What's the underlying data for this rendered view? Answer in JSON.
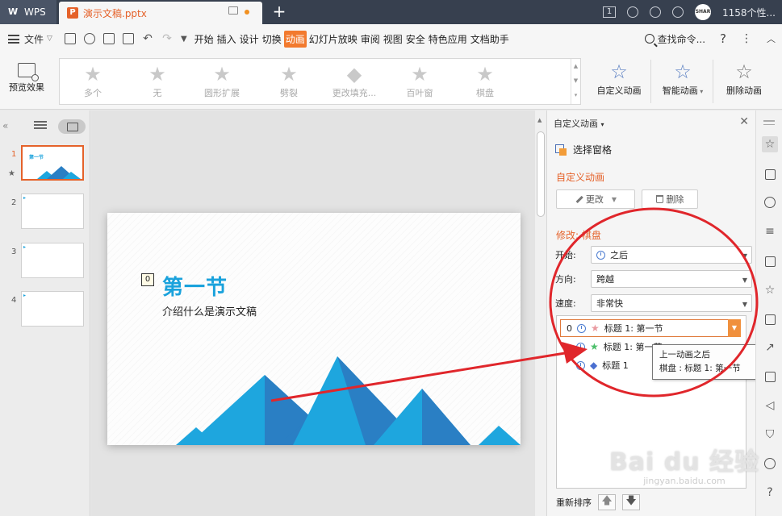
{
  "titlebar": {
    "app_name": "WPS",
    "doc_tab": "演示文稿.pptx",
    "badge": "1",
    "user_name": "1158个性..."
  },
  "menubar": {
    "file": "文件",
    "items": [
      "开始",
      "插入",
      "设计",
      "切换",
      "动画",
      "幻灯片放映",
      "审阅",
      "视图",
      "安全",
      "特色应用",
      "文档助手"
    ],
    "active_index": 4,
    "search": "查找命令...",
    "help": "?"
  },
  "ribbon": {
    "preview": "预览效果",
    "gallery": [
      "多个",
      "无",
      "圆形扩展",
      "劈裂",
      "更改填充...",
      "百叶窗",
      "棋盘"
    ],
    "custom_anim": "自定义动画",
    "smart_anim": "智能动画",
    "delete_anim": "删除动画"
  },
  "thumbnails": {
    "numbers": [
      "1",
      "2",
      "3",
      "4"
    ],
    "active": 1,
    "thumb_title": "第一节"
  },
  "slide": {
    "anim_order": "0",
    "title": "第一节",
    "subtitle": "介绍什么是演示文稿"
  },
  "task_pane": {
    "header": "自定义动画",
    "select_pane": "选择窗格",
    "section_title": "自定义动画",
    "modify_button": "更改",
    "delete_button": "删除",
    "modify_label": "修改: 棋盘",
    "start_label": "开始:",
    "start_value": "之后",
    "direction_label": "方向:",
    "direction_value": "跨越",
    "speed_label": "速度:",
    "speed_value": "非常快",
    "anim_items": [
      {
        "order": "0",
        "text": "标题 1: 第一节"
      },
      {
        "order": "",
        "text": "标题 1: 第一节"
      },
      {
        "order": "",
        "text": "标题 1"
      }
    ],
    "tooltip_line1": "上一动画之后",
    "tooltip_line2": "棋盘 : 标题 1: 第一节",
    "reorder_label": "重新排序"
  },
  "watermark": {
    "main": "Bai du 经验",
    "sub": "jingyan.baidu.com"
  },
  "colors": {
    "accent_orange": "#e5622a",
    "title_blue": "#1aa2dc",
    "annotation_red": "#e0262b",
    "mountain_light": "#1ea6de",
    "mountain_dark": "#2a7fc4"
  }
}
